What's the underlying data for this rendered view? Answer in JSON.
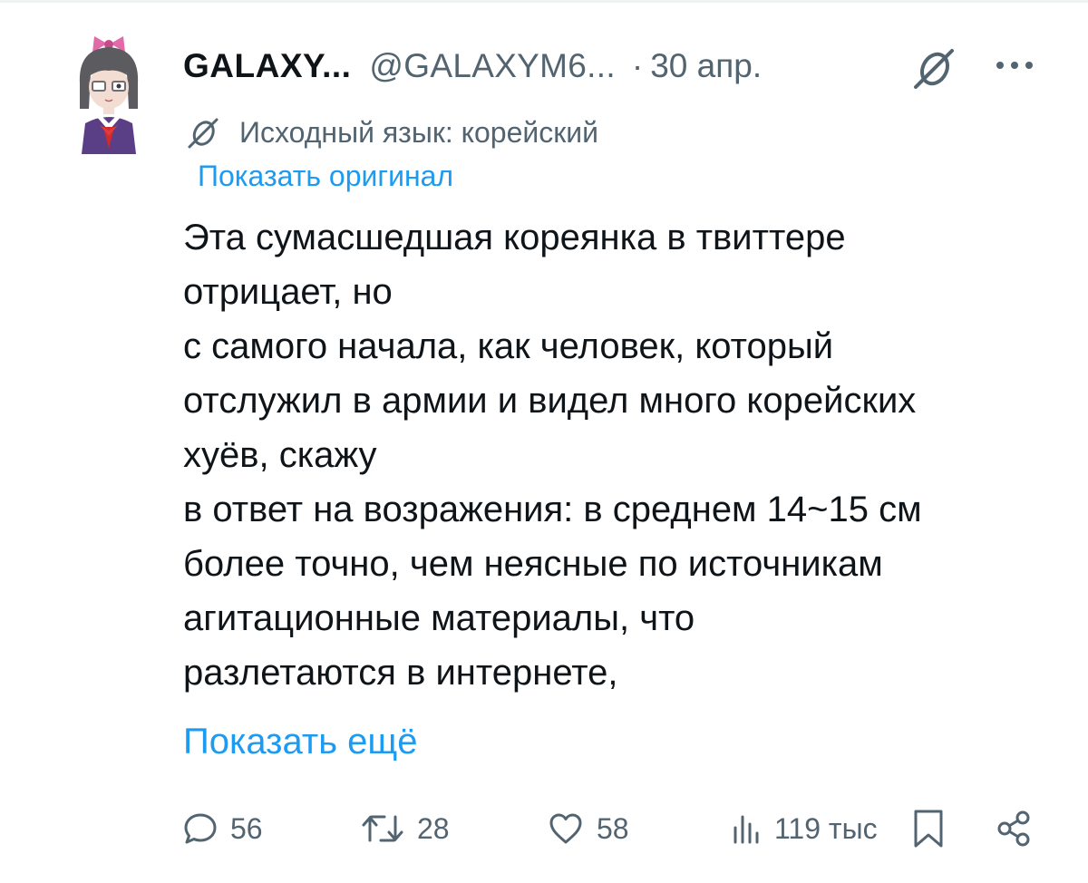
{
  "tweet": {
    "display_name": "GALAXY...",
    "handle": "@GALAXYM6...",
    "separator": "·",
    "date": "30 апр.",
    "translation_notice": "Исходный язык: корейский",
    "show_original": "Показать оригинал",
    "text_lines": [
      "Эта сумасшедшая кореянка в твиттере",
      "отрицает, но",
      "с самого начала, как человек, который",
      "отслужил в армии и видел много корейских",
      "хуёв, скажу",
      "в ответ на возражения: в среднем 14~15 см",
      "более точно, чем неясные по источникам",
      "агитационные материалы, что",
      "разлетаются в интернете,"
    ],
    "show_more": "Показать ещё"
  },
  "actions": {
    "replies": "56",
    "retweets": "28",
    "likes": "58",
    "views": "119 тыс"
  },
  "icons": {
    "avatar": "anime-avatar",
    "grok": "grok-icon",
    "more": "more-dots-icon",
    "reply": "reply-icon",
    "retweet": "retweet-icon",
    "like": "heart-icon",
    "views": "views-bar-icon",
    "bookmark": "bookmark-icon",
    "share": "share-icon"
  },
  "colors": {
    "text": "#0f1419",
    "secondary": "#536471",
    "link": "#1d9bf0"
  }
}
